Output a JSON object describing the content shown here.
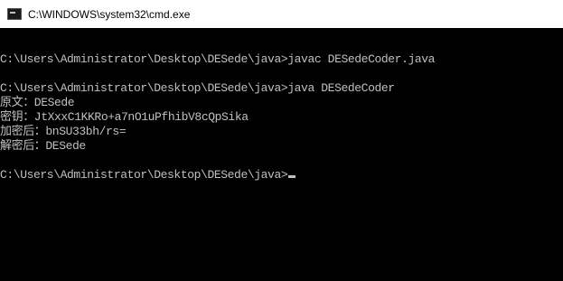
{
  "window": {
    "title": "C:\\WINDOWS\\system32\\cmd.exe",
    "icon": "cmd-icon"
  },
  "console": {
    "lines": [
      "",
      "C:\\Users\\Administrator\\Desktop\\DESede\\java>javac DESedeCoder.java",
      "",
      "C:\\Users\\Administrator\\Desktop\\DESede\\java>java DESedeCoder",
      "原文：DESede",
      "密钥：JtXxxC1KKRo+a7nO1uPfhibV8cQpSika",
      "加密后：bnSU33bh/rs=",
      "解密后：DESede",
      "",
      "C:\\Users\\Administrator\\Desktop\\DESede\\java>"
    ]
  },
  "colors": {
    "background": "#000000",
    "text": "#c0c0c0",
    "titlebar": "#ffffff"
  }
}
